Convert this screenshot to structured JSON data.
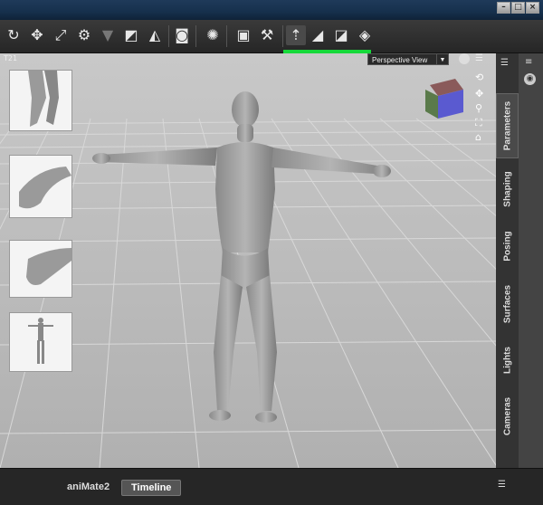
{
  "toolbar": {
    "icons": [
      "rotate-icon",
      "translate-icon",
      "scale-icon",
      "joint-editor-icon",
      "cone-icon",
      "surface-selection-icon",
      "node-selection-icon",
      "camera-icon",
      "settings-icon",
      "render-icon",
      "render-settings-icon",
      "figure-tool-icon",
      "shaping-tool-icon",
      "spot-render-icon",
      "paint-icon"
    ]
  },
  "viewport": {
    "label": "T21",
    "view_name": "Perspective View",
    "progress_fraction": 1.0,
    "progress_color": "#16d93a"
  },
  "side_tabs": [
    {
      "label": "Parameters",
      "active": true
    },
    {
      "label": "Shaping",
      "active": false
    },
    {
      "label": "Posing",
      "active": false
    },
    {
      "label": "Surfaces",
      "active": false
    },
    {
      "label": "Lights",
      "active": false
    },
    {
      "label": "Cameras",
      "active": false
    }
  ],
  "bottom_tabs": [
    {
      "label": "aniMate2",
      "active": false
    },
    {
      "label": "Timeline",
      "active": true
    }
  ],
  "colors": {
    "accent": "#16d93a",
    "viewport_bg": "#bdbdbd"
  }
}
